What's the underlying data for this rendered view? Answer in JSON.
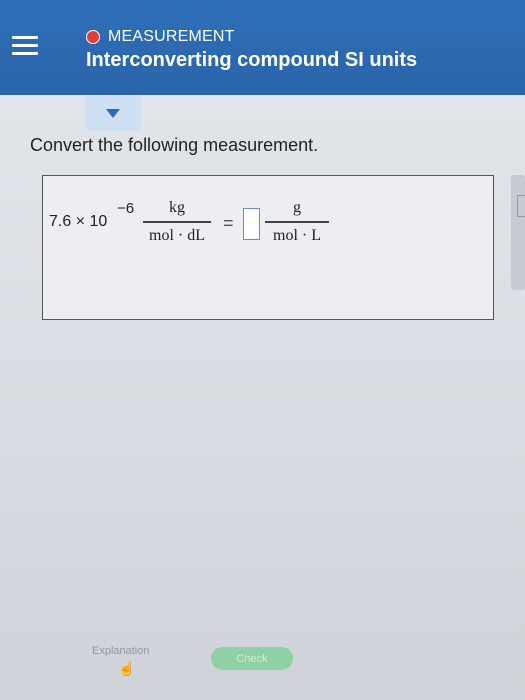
{
  "header": {
    "topic": "MEASUREMENT",
    "title": "Interconverting compound SI units"
  },
  "question": {
    "prompt": "Convert the following measurement.",
    "coefficient": "7.6 × 10",
    "exponent": "−6",
    "given_unit": {
      "numerator": "kg",
      "denominator": "mol · dL"
    },
    "equals": "=",
    "target_unit": {
      "numerator": "g",
      "denominator": "mol · L"
    }
  },
  "footer": {
    "explanation_label": "Explanation",
    "check_label": "Check"
  },
  "colors": {
    "header_bg": "#2c69b0",
    "topic_dot": "#e23b3b",
    "check_button": "#8fd1a4"
  }
}
